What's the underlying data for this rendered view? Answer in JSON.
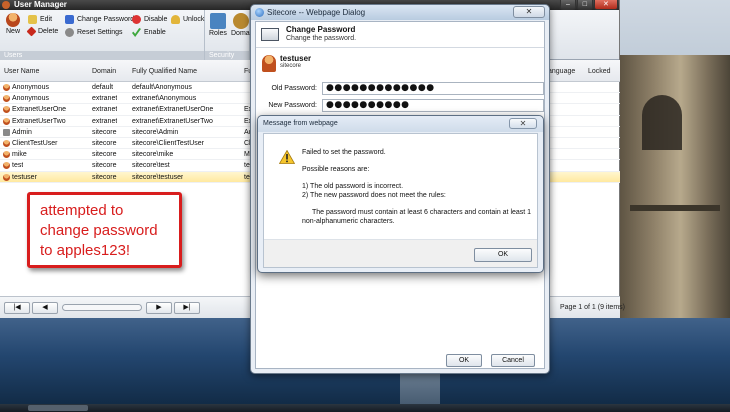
{
  "app": {
    "title": "User Manager"
  },
  "ribbon": {
    "users_group": {
      "label": "Users",
      "new": "New",
      "edit": "Edit",
      "delete": "Delete",
      "change_password": "Change Password",
      "reset_settings": "Reset Settings",
      "disable": "Disable",
      "enable": "Enable",
      "unlock": "Unlock"
    },
    "security_group": {
      "label": "Security",
      "roles": "Roles",
      "domain": "Domai"
    }
  },
  "grid": {
    "columns": [
      "User Name",
      "Domain",
      "Fully Qualified Name",
      "Fu",
      "anguage",
      "Locked"
    ],
    "rows": [
      {
        "name": "Anonymous",
        "domain": "default",
        "fqn": "default\\Anonymous",
        "fu": ""
      },
      {
        "name": "Anonymous",
        "domain": "extranet",
        "fqn": "extranet\\Anonymous",
        "fu": ""
      },
      {
        "name": "ExtranetUserOne",
        "domain": "extranet",
        "fqn": "extranet\\ExtranetUserOne",
        "fu": "Ex"
      },
      {
        "name": "ExtranetUserTwo",
        "domain": "extranet",
        "fqn": "extranet\\ExtranetUserTwo",
        "fu": "Ex"
      },
      {
        "name": "Admin",
        "domain": "sitecore",
        "fqn": "sitecore\\Admin",
        "fu": "Ad"
      },
      {
        "name": "ClientTestUser",
        "domain": "sitecore",
        "fqn": "sitecore\\ClientTestUser",
        "fu": "Cl"
      },
      {
        "name": "mike",
        "domain": "sitecore",
        "fqn": "sitecore\\mike",
        "fu": "Mi"
      },
      {
        "name": "test",
        "domain": "sitecore",
        "fqn": "sitecore\\test",
        "fu": "tes"
      },
      {
        "name": "testuser",
        "domain": "sitecore",
        "fqn": "sitecore\\testuser",
        "fu": "tes"
      }
    ],
    "selected_index": 8
  },
  "pager": {
    "first": "|◀",
    "prev": "◀",
    "next": "▶",
    "last": "▶|",
    "info": "Page 1 of 1 (9 items)"
  },
  "callout": {
    "text": "attempted to change password to apples123!"
  },
  "dialog": {
    "title": "Sitecore -- Webpage Dialog",
    "close": "✕",
    "heading": "Change Password",
    "subheading": "Change the password.",
    "username": "testuser",
    "domain": "sitecore",
    "old_password_label": "Old Password:",
    "old_password_value": "●●●●●●●●●●●●●",
    "new_password_label": "New Password:",
    "new_password_value": "●●●●●●●●●●",
    "ok": "OK",
    "cancel": "Cancel"
  },
  "message": {
    "title": "Message from webpage",
    "close": "✕",
    "line1": "Failed to set the password.",
    "line2": "Possible reasons are:",
    "reason1": "1) The old password is incorrect.",
    "reason2": "2) The new password does not meet the rules:",
    "rule": "The password must contain at least 6 characters and contain at least 1 non-alphanumeric characters.",
    "ok": "OK"
  },
  "window_controls": {
    "min": "–",
    "max": "□",
    "close": "✕"
  }
}
